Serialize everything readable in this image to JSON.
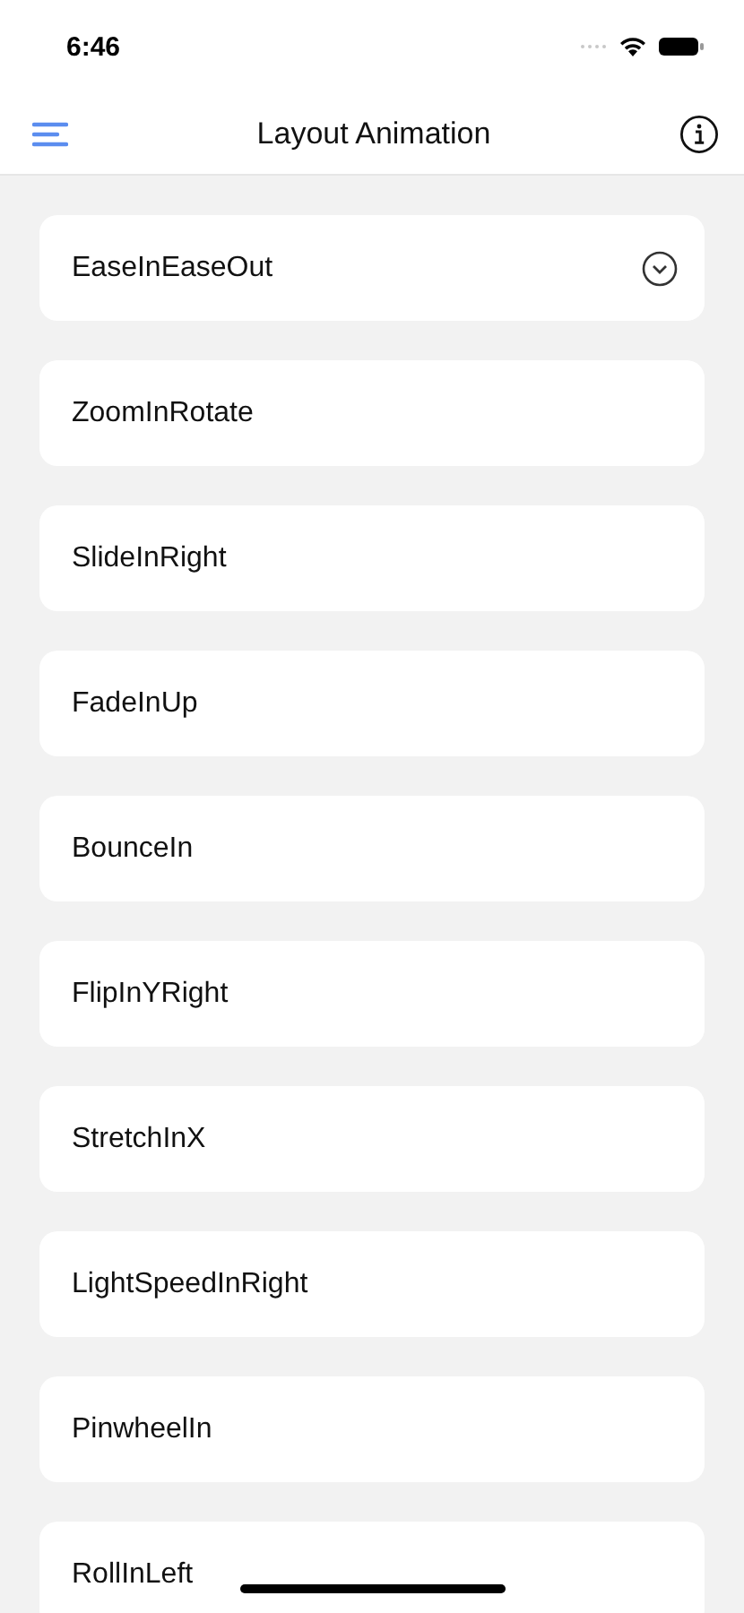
{
  "status_bar": {
    "time": "6:46"
  },
  "nav_bar": {
    "title": "Layout Animation"
  },
  "items": [
    {
      "label": "EaseInEaseOut",
      "selected": true
    },
    {
      "label": "ZoomInRotate",
      "selected": false
    },
    {
      "label": "SlideInRight",
      "selected": false
    },
    {
      "label": "FadeInUp",
      "selected": false
    },
    {
      "label": "BounceIn",
      "selected": false
    },
    {
      "label": "FlipInYRight",
      "selected": false
    },
    {
      "label": "StretchInX",
      "selected": false
    },
    {
      "label": "LightSpeedInRight",
      "selected": false
    },
    {
      "label": "PinwheelIn",
      "selected": false
    },
    {
      "label": "RollInLeft",
      "selected": false
    }
  ]
}
